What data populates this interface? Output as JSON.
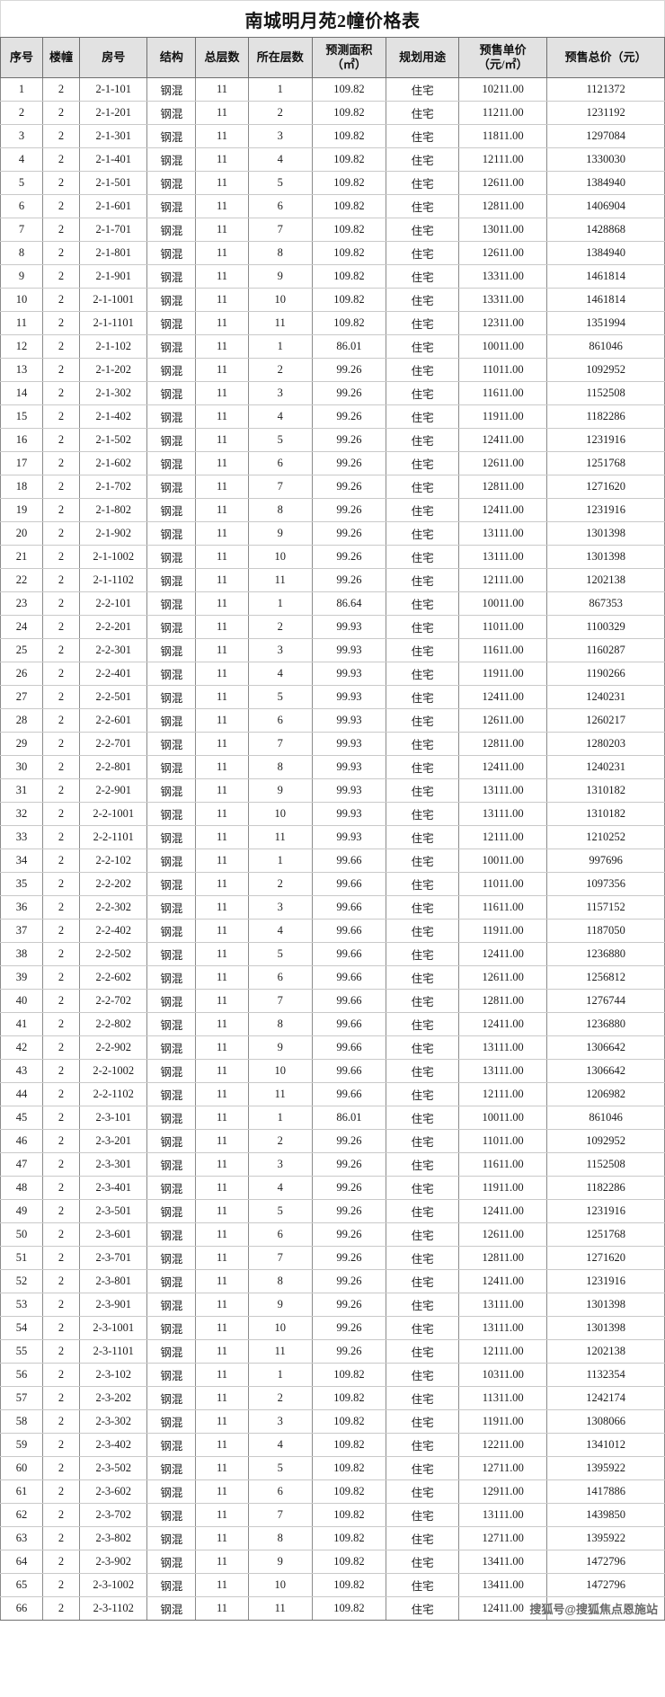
{
  "document": {
    "title": "南城明月苑2幢价格表"
  },
  "watermark": {
    "text": "搜狐号@搜狐焦点恩施站"
  },
  "table": {
    "columns": [
      {
        "key": "seq",
        "label": "序号"
      },
      {
        "key": "bldg",
        "label": "楼幢"
      },
      {
        "key": "room",
        "label": "房号"
      },
      {
        "key": "struct",
        "label": "结构"
      },
      {
        "key": "floors",
        "label": "总层数"
      },
      {
        "key": "onfl",
        "label": "所在层数"
      },
      {
        "key": "area",
        "label": "预测面积",
        "label2": "（㎡）"
      },
      {
        "key": "use",
        "label": "规划用途"
      },
      {
        "key": "unit",
        "label": "预售单价",
        "label2": "（元/㎡）"
      },
      {
        "key": "total",
        "label": "预售总价（元）"
      }
    ],
    "rows": [
      [
        "1",
        "2",
        "2-1-101",
        "钢混",
        "11",
        "1",
        "109.82",
        "住宅",
        "10211.00",
        "1121372"
      ],
      [
        "2",
        "2",
        "2-1-201",
        "钢混",
        "11",
        "2",
        "109.82",
        "住宅",
        "11211.00",
        "1231192"
      ],
      [
        "3",
        "2",
        "2-1-301",
        "钢混",
        "11",
        "3",
        "109.82",
        "住宅",
        "11811.00",
        "1297084"
      ],
      [
        "4",
        "2",
        "2-1-401",
        "钢混",
        "11",
        "4",
        "109.82",
        "住宅",
        "12111.00",
        "1330030"
      ],
      [
        "5",
        "2",
        "2-1-501",
        "钢混",
        "11",
        "5",
        "109.82",
        "住宅",
        "12611.00",
        "1384940"
      ],
      [
        "6",
        "2",
        "2-1-601",
        "钢混",
        "11",
        "6",
        "109.82",
        "住宅",
        "12811.00",
        "1406904"
      ],
      [
        "7",
        "2",
        "2-1-701",
        "钢混",
        "11",
        "7",
        "109.82",
        "住宅",
        "13011.00",
        "1428868"
      ],
      [
        "8",
        "2",
        "2-1-801",
        "钢混",
        "11",
        "8",
        "109.82",
        "住宅",
        "12611.00",
        "1384940"
      ],
      [
        "9",
        "2",
        "2-1-901",
        "钢混",
        "11",
        "9",
        "109.82",
        "住宅",
        "13311.00",
        "1461814"
      ],
      [
        "10",
        "2",
        "2-1-1001",
        "钢混",
        "11",
        "10",
        "109.82",
        "住宅",
        "13311.00",
        "1461814"
      ],
      [
        "11",
        "2",
        "2-1-1101",
        "钢混",
        "11",
        "11",
        "109.82",
        "住宅",
        "12311.00",
        "1351994"
      ],
      [
        "12",
        "2",
        "2-1-102",
        "钢混",
        "11",
        "1",
        "86.01",
        "住宅",
        "10011.00",
        "861046"
      ],
      [
        "13",
        "2",
        "2-1-202",
        "钢混",
        "11",
        "2",
        "99.26",
        "住宅",
        "11011.00",
        "1092952"
      ],
      [
        "14",
        "2",
        "2-1-302",
        "钢混",
        "11",
        "3",
        "99.26",
        "住宅",
        "11611.00",
        "1152508"
      ],
      [
        "15",
        "2",
        "2-1-402",
        "钢混",
        "11",
        "4",
        "99.26",
        "住宅",
        "11911.00",
        "1182286"
      ],
      [
        "16",
        "2",
        "2-1-502",
        "钢混",
        "11",
        "5",
        "99.26",
        "住宅",
        "12411.00",
        "1231916"
      ],
      [
        "17",
        "2",
        "2-1-602",
        "钢混",
        "11",
        "6",
        "99.26",
        "住宅",
        "12611.00",
        "1251768"
      ],
      [
        "18",
        "2",
        "2-1-702",
        "钢混",
        "11",
        "7",
        "99.26",
        "住宅",
        "12811.00",
        "1271620"
      ],
      [
        "19",
        "2",
        "2-1-802",
        "钢混",
        "11",
        "8",
        "99.26",
        "住宅",
        "12411.00",
        "1231916"
      ],
      [
        "20",
        "2",
        "2-1-902",
        "钢混",
        "11",
        "9",
        "99.26",
        "住宅",
        "13111.00",
        "1301398"
      ],
      [
        "21",
        "2",
        "2-1-1002",
        "钢混",
        "11",
        "10",
        "99.26",
        "住宅",
        "13111.00",
        "1301398"
      ],
      [
        "22",
        "2",
        "2-1-1102",
        "钢混",
        "11",
        "11",
        "99.26",
        "住宅",
        "12111.00",
        "1202138"
      ],
      [
        "23",
        "2",
        "2-2-101",
        "钢混",
        "11",
        "1",
        "86.64",
        "住宅",
        "10011.00",
        "867353"
      ],
      [
        "24",
        "2",
        "2-2-201",
        "钢混",
        "11",
        "2",
        "99.93",
        "住宅",
        "11011.00",
        "1100329"
      ],
      [
        "25",
        "2",
        "2-2-301",
        "钢混",
        "11",
        "3",
        "99.93",
        "住宅",
        "11611.00",
        "1160287"
      ],
      [
        "26",
        "2",
        "2-2-401",
        "钢混",
        "11",
        "4",
        "99.93",
        "住宅",
        "11911.00",
        "1190266"
      ],
      [
        "27",
        "2",
        "2-2-501",
        "钢混",
        "11",
        "5",
        "99.93",
        "住宅",
        "12411.00",
        "1240231"
      ],
      [
        "28",
        "2",
        "2-2-601",
        "钢混",
        "11",
        "6",
        "99.93",
        "住宅",
        "12611.00",
        "1260217"
      ],
      [
        "29",
        "2",
        "2-2-701",
        "钢混",
        "11",
        "7",
        "99.93",
        "住宅",
        "12811.00",
        "1280203"
      ],
      [
        "30",
        "2",
        "2-2-801",
        "钢混",
        "11",
        "8",
        "99.93",
        "住宅",
        "12411.00",
        "1240231"
      ],
      [
        "31",
        "2",
        "2-2-901",
        "钢混",
        "11",
        "9",
        "99.93",
        "住宅",
        "13111.00",
        "1310182"
      ],
      [
        "32",
        "2",
        "2-2-1001",
        "钢混",
        "11",
        "10",
        "99.93",
        "住宅",
        "13111.00",
        "1310182"
      ],
      [
        "33",
        "2",
        "2-2-1101",
        "钢混",
        "11",
        "11",
        "99.93",
        "住宅",
        "12111.00",
        "1210252"
      ],
      [
        "34",
        "2",
        "2-2-102",
        "钢混",
        "11",
        "1",
        "99.66",
        "住宅",
        "10011.00",
        "997696"
      ],
      [
        "35",
        "2",
        "2-2-202",
        "钢混",
        "11",
        "2",
        "99.66",
        "住宅",
        "11011.00",
        "1097356"
      ],
      [
        "36",
        "2",
        "2-2-302",
        "钢混",
        "11",
        "3",
        "99.66",
        "住宅",
        "11611.00",
        "1157152"
      ],
      [
        "37",
        "2",
        "2-2-402",
        "钢混",
        "11",
        "4",
        "99.66",
        "住宅",
        "11911.00",
        "1187050"
      ],
      [
        "38",
        "2",
        "2-2-502",
        "钢混",
        "11",
        "5",
        "99.66",
        "住宅",
        "12411.00",
        "1236880"
      ],
      [
        "39",
        "2",
        "2-2-602",
        "钢混",
        "11",
        "6",
        "99.66",
        "住宅",
        "12611.00",
        "1256812"
      ],
      [
        "40",
        "2",
        "2-2-702",
        "钢混",
        "11",
        "7",
        "99.66",
        "住宅",
        "12811.00",
        "1276744"
      ],
      [
        "41",
        "2",
        "2-2-802",
        "钢混",
        "11",
        "8",
        "99.66",
        "住宅",
        "12411.00",
        "1236880"
      ],
      [
        "42",
        "2",
        "2-2-902",
        "钢混",
        "11",
        "9",
        "99.66",
        "住宅",
        "13111.00",
        "1306642"
      ],
      [
        "43",
        "2",
        "2-2-1002",
        "钢混",
        "11",
        "10",
        "99.66",
        "住宅",
        "13111.00",
        "1306642"
      ],
      [
        "44",
        "2",
        "2-2-1102",
        "钢混",
        "11",
        "11",
        "99.66",
        "住宅",
        "12111.00",
        "1206982"
      ],
      [
        "45",
        "2",
        "2-3-101",
        "钢混",
        "11",
        "1",
        "86.01",
        "住宅",
        "10011.00",
        "861046"
      ],
      [
        "46",
        "2",
        "2-3-201",
        "钢混",
        "11",
        "2",
        "99.26",
        "住宅",
        "11011.00",
        "1092952"
      ],
      [
        "47",
        "2",
        "2-3-301",
        "钢混",
        "11",
        "3",
        "99.26",
        "住宅",
        "11611.00",
        "1152508"
      ],
      [
        "48",
        "2",
        "2-3-401",
        "钢混",
        "11",
        "4",
        "99.26",
        "住宅",
        "11911.00",
        "1182286"
      ],
      [
        "49",
        "2",
        "2-3-501",
        "钢混",
        "11",
        "5",
        "99.26",
        "住宅",
        "12411.00",
        "1231916"
      ],
      [
        "50",
        "2",
        "2-3-601",
        "钢混",
        "11",
        "6",
        "99.26",
        "住宅",
        "12611.00",
        "1251768"
      ],
      [
        "51",
        "2",
        "2-3-701",
        "钢混",
        "11",
        "7",
        "99.26",
        "住宅",
        "12811.00",
        "1271620"
      ],
      [
        "52",
        "2",
        "2-3-801",
        "钢混",
        "11",
        "8",
        "99.26",
        "住宅",
        "12411.00",
        "1231916"
      ],
      [
        "53",
        "2",
        "2-3-901",
        "钢混",
        "11",
        "9",
        "99.26",
        "住宅",
        "13111.00",
        "1301398"
      ],
      [
        "54",
        "2",
        "2-3-1001",
        "钢混",
        "11",
        "10",
        "99.26",
        "住宅",
        "13111.00",
        "1301398"
      ],
      [
        "55",
        "2",
        "2-3-1101",
        "钢混",
        "11",
        "11",
        "99.26",
        "住宅",
        "12111.00",
        "1202138"
      ],
      [
        "56",
        "2",
        "2-3-102",
        "钢混",
        "11",
        "1",
        "109.82",
        "住宅",
        "10311.00",
        "1132354"
      ],
      [
        "57",
        "2",
        "2-3-202",
        "钢混",
        "11",
        "2",
        "109.82",
        "住宅",
        "11311.00",
        "1242174"
      ],
      [
        "58",
        "2",
        "2-3-302",
        "钢混",
        "11",
        "3",
        "109.82",
        "住宅",
        "11911.00",
        "1308066"
      ],
      [
        "59",
        "2",
        "2-3-402",
        "钢混",
        "11",
        "4",
        "109.82",
        "住宅",
        "12211.00",
        "1341012"
      ],
      [
        "60",
        "2",
        "2-3-502",
        "钢混",
        "11",
        "5",
        "109.82",
        "住宅",
        "12711.00",
        "1395922"
      ],
      [
        "61",
        "2",
        "2-3-602",
        "钢混",
        "11",
        "6",
        "109.82",
        "住宅",
        "12911.00",
        "1417886"
      ],
      [
        "62",
        "2",
        "2-3-702",
        "钢混",
        "11",
        "7",
        "109.82",
        "住宅",
        "13111.00",
        "1439850"
      ],
      [
        "63",
        "2",
        "2-3-802",
        "钢混",
        "11",
        "8",
        "109.82",
        "住宅",
        "12711.00",
        "1395922"
      ],
      [
        "64",
        "2",
        "2-3-902",
        "钢混",
        "11",
        "9",
        "109.82",
        "住宅",
        "13411.00",
        "1472796"
      ],
      [
        "65",
        "2",
        "2-3-1002",
        "钢混",
        "11",
        "10",
        "109.82",
        "住宅",
        "13411.00",
        "1472796"
      ],
      [
        "66",
        "2",
        "2-3-1102",
        "钢混",
        "11",
        "11",
        "109.82",
        "住宅",
        "12411.00",
        ""
      ]
    ]
  }
}
